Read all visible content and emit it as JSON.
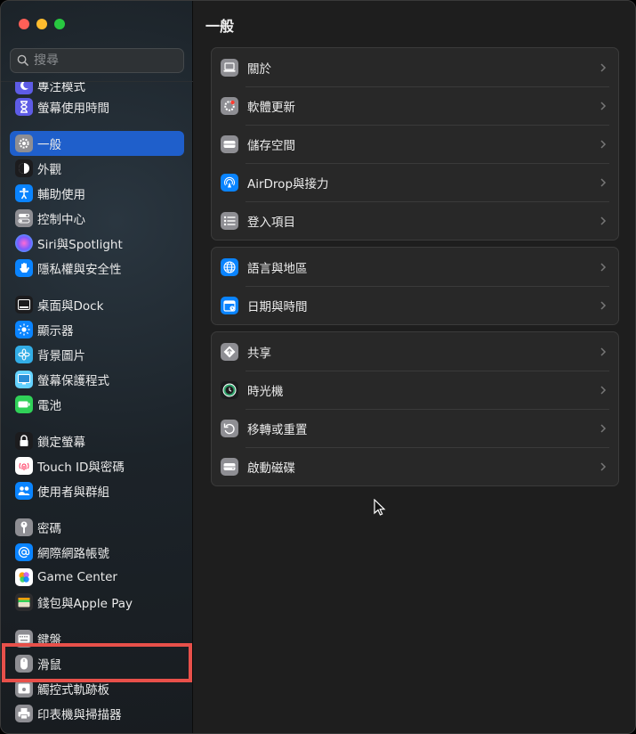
{
  "search": {
    "placeholder": "搜尋"
  },
  "page": {
    "title": "一般"
  },
  "sidebar": {
    "items": [
      {
        "label": "專注模式",
        "icon": "moon-icon",
        "color": "#5e5ce6"
      },
      {
        "label": "螢幕使用時間",
        "icon": "hourglass-icon",
        "color": "#5e5ce6"
      },
      {
        "label": "一般",
        "icon": "gear-icon",
        "color": "#8e8e93",
        "selected": true
      },
      {
        "label": "外觀",
        "icon": "appearance-icon",
        "color": "#1c1c1e"
      },
      {
        "label": "輔助使用",
        "icon": "accessibility-icon",
        "color": "#0a84ff"
      },
      {
        "label": "控制中心",
        "icon": "control-center-icon",
        "color": "#8e8e93"
      },
      {
        "label": "Siri與Spotlight",
        "icon": "siri-icon",
        "color": "#bf5af2"
      },
      {
        "label": "隱私權與安全性",
        "icon": "hand-icon",
        "color": "#0a84ff"
      },
      {
        "label": "桌面與Dock",
        "icon": "dock-icon",
        "color": "#1c1c1e"
      },
      {
        "label": "顯示器",
        "icon": "sun-icon",
        "color": "#0a84ff"
      },
      {
        "label": "背景圖片",
        "icon": "flower-icon",
        "color": "#32ade6"
      },
      {
        "label": "螢幕保護程式",
        "icon": "screensaver-icon",
        "color": "#64d2ff"
      },
      {
        "label": "電池",
        "icon": "battery-icon",
        "color": "#30d158"
      },
      {
        "label": "鎖定螢幕",
        "icon": "lock-icon",
        "color": "#1c1c1e"
      },
      {
        "label": "Touch ID與密碼",
        "icon": "fingerprint-icon",
        "color": "#ffffff"
      },
      {
        "label": "使用者與群組",
        "icon": "users-icon",
        "color": "#0a84ff"
      },
      {
        "label": "密碼",
        "icon": "key-icon",
        "color": "#8e8e93"
      },
      {
        "label": "網際網路帳號",
        "icon": "at-icon",
        "color": "#0a84ff"
      },
      {
        "label": "Game Center",
        "icon": "game-center-icon",
        "color": "#ffffff"
      },
      {
        "label": "錢包與Apple Pay",
        "icon": "wallet-icon",
        "color": "#2c2c2e"
      },
      {
        "label": "鍵盤",
        "icon": "keyboard-icon",
        "color": "#8e8e93"
      },
      {
        "label": "滑鼠",
        "icon": "mouse-icon",
        "color": "#8e8e93"
      },
      {
        "label": "觸控式軌跡板",
        "icon": "trackpad-icon",
        "color": "#8e8e93"
      },
      {
        "label": "印表機與掃描器",
        "icon": "printer-icon",
        "color": "#8e8e93"
      }
    ]
  },
  "groups": [
    {
      "rows": [
        {
          "label": "關於",
          "icon": "laptop-icon"
        },
        {
          "label": "軟體更新",
          "icon": "software-update-icon"
        },
        {
          "label": "儲存空間",
          "icon": "storage-icon"
        },
        {
          "label": "AirDrop與接力",
          "icon": "airdrop-icon"
        },
        {
          "label": "登入項目",
          "icon": "list-icon"
        }
      ]
    },
    {
      "rows": [
        {
          "label": "語言與地區",
          "icon": "globe-icon"
        },
        {
          "label": "日期與時間",
          "icon": "calendar-icon"
        }
      ]
    },
    {
      "rows": [
        {
          "label": "共享",
          "icon": "sharing-icon"
        },
        {
          "label": "時光機",
          "icon": "time-machine-icon"
        },
        {
          "label": "移轉或重置",
          "icon": "reset-icon"
        },
        {
          "label": "啟動磁碟",
          "icon": "disk-icon"
        }
      ]
    }
  ]
}
